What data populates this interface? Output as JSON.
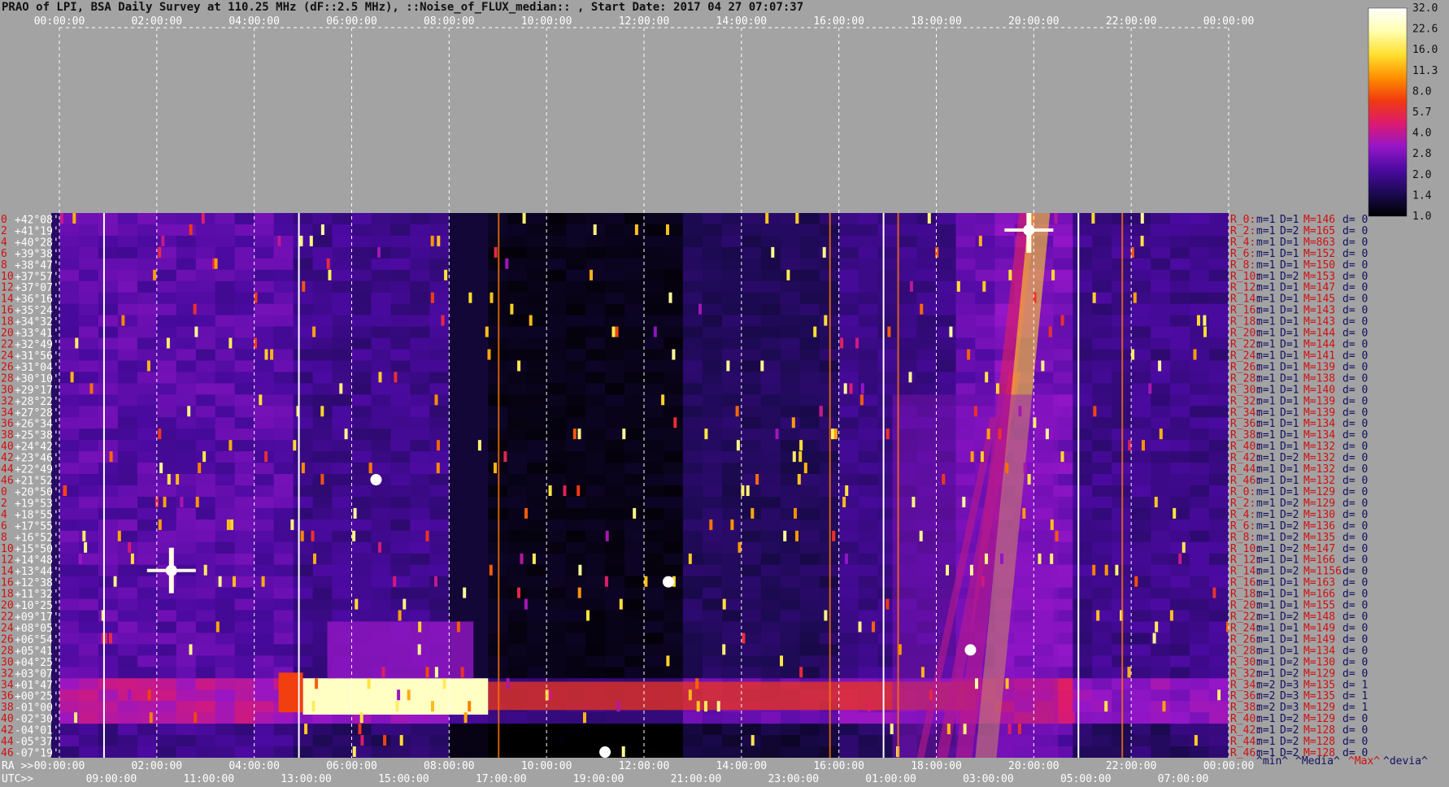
{
  "title": "PRAO of LPI, BSA Daily Survey at 110.25 MHz (dF::2.5 MHz), ::Noise_of_FLUX_median:: , Start Date: 2017 04 27 07:07:37",
  "chart_data": {
    "type": "heatmap",
    "top_axis_labels": [
      "00:00:00",
      "02:00:00",
      "04:00:00",
      "06:00:00",
      "08:00:00",
      "10:00:00",
      "12:00:00",
      "14:00:00",
      "16:00:00",
      "18:00:00",
      "20:00:00",
      "22:00:00",
      "00:00:00"
    ],
    "ra_axis_prefix": "RA >>",
    "ra_axis_labels": [
      "00:00:00",
      "02:00:00",
      "04:00:00",
      "06:00:00",
      "08:00:00",
      "10:00:00",
      "12:00:00",
      "14:00:00",
      "16:00:00",
      "18:00:00",
      "20:00:00",
      "22:00:00",
      "00:00:00"
    ],
    "utc_axis_prefix": "UTC>>",
    "utc_axis_labels": [
      "09:00:00",
      "11:00:00",
      "13:00:00",
      "15:00:00",
      "17:00:00",
      "19:00:00",
      "21:00:00",
      "23:00:00",
      "01:00:00",
      "03:00:00",
      "05:00:00",
      "07:00:00"
    ],
    "declinations": [
      "+42°08'",
      "+41°19'",
      "+40°28'",
      "+39°38'",
      "+38°47'",
      "+37°57'",
      "+37°07'",
      "+36°16'",
      "+35°24'",
      "+34°32'",
      "+33°41'",
      "+32°49'",
      "+31°56'",
      "+31°04'",
      "+30°10'",
      "+29°17'",
      "+28°22'",
      "+27°28'",
      "+26°34'",
      "+25°38'",
      "+24°42'",
      "+23°46'",
      "+22°49'",
      "+21°52'",
      "+20°50'",
      "+19°53'",
      "+18°55'",
      "+17°55'",
      "+16°52'",
      "+15°50'",
      "+14°48'",
      "+13°44'",
      "+12°38'",
      "+11°32'",
      "+10°25'",
      "+09°17'",
      "+08°05'",
      "+06°54'",
      "+05°41'",
      "+04°25'",
      "+03°07'",
      "+01°47'",
      "+00°25'",
      "-01°00'",
      "-02°30'",
      "-04°01'",
      "-05°37'",
      "-07°19'"
    ],
    "row_numbers_left": [
      "0",
      "2",
      "4",
      "6",
      "8",
      "10",
      "12",
      "14",
      "16",
      "18",
      "20",
      "22",
      "24",
      "26",
      "28",
      "30",
      "32",
      "34",
      "36",
      "38",
      "40",
      "42",
      "44",
      "46",
      "0",
      "2",
      "4",
      "6",
      "8",
      "10",
      "12",
      "14",
      "16",
      "18",
      "20",
      "22",
      "24",
      "26",
      "28",
      "30",
      "32",
      "34",
      "36",
      "38",
      "40",
      "42",
      "44",
      "46"
    ],
    "right_stats": [
      {
        "r": "R_0:",
        "m": "m=1",
        "d": "D=1",
        "M": "M=146",
        "dev": "d= 0"
      },
      {
        "r": "R_2:",
        "m": "m=1",
        "d": "D=2",
        "M": "M=165",
        "dev": "d= 0"
      },
      {
        "r": "R_4:",
        "m": "m=1",
        "d": "D=1",
        "M": "M=863",
        "dev": "d= 0"
      },
      {
        "r": "R_6:",
        "m": "m=1",
        "d": "D=1",
        "M": "M=152",
        "dev": "d= 0"
      },
      {
        "r": "R_8:",
        "m": "m=1",
        "d": "D=1",
        "M": "M=150",
        "dev": "d= 0"
      },
      {
        "r": "R_10:",
        "m": "m=1",
        "d": "D=2",
        "M": "M=153",
        "dev": "d= 0"
      },
      {
        "r": "R_12:",
        "m": "m=1",
        "d": "D=1",
        "M": "M=147",
        "dev": "d= 0"
      },
      {
        "r": "R_14:",
        "m": "m=1",
        "d": "D=1",
        "M": "M=145",
        "dev": "d= 0"
      },
      {
        "r": "R_16:",
        "m": "m=1",
        "d": "D=1",
        "M": "M=143",
        "dev": "d= 0"
      },
      {
        "r": "R_18:",
        "m": "m=1",
        "d": "D=1",
        "M": "M=143",
        "dev": "d= 0"
      },
      {
        "r": "R_20:",
        "m": "m=1",
        "d": "D=1",
        "M": "M=144",
        "dev": "d= 0"
      },
      {
        "r": "R_22:",
        "m": "m=1",
        "d": "D=1",
        "M": "M=144",
        "dev": "d= 0"
      },
      {
        "r": "R_24:",
        "m": "m=1",
        "d": "D=1",
        "M": "M=141",
        "dev": "d= 0"
      },
      {
        "r": "R_26:",
        "m": "m=1",
        "d": "D=1",
        "M": "M=139",
        "dev": "d= 0"
      },
      {
        "r": "R_28:",
        "m": "m=1",
        "d": "D=1",
        "M": "M=138",
        "dev": "d= 0"
      },
      {
        "r": "R_30:",
        "m": "m=1",
        "d": "D=1",
        "M": "M=140",
        "dev": "d= 0"
      },
      {
        "r": "R_32:",
        "m": "m=1",
        "d": "D=1",
        "M": "M=139",
        "dev": "d= 0"
      },
      {
        "r": "R_34:",
        "m": "m=1",
        "d": "D=1",
        "M": "M=139",
        "dev": "d= 0"
      },
      {
        "r": "R_36:",
        "m": "m=1",
        "d": "D=1",
        "M": "M=134",
        "dev": "d= 0"
      },
      {
        "r": "R_38:",
        "m": "m=1",
        "d": "D=1",
        "M": "M=134",
        "dev": "d= 0"
      },
      {
        "r": "R_40:",
        "m": "m=1",
        "d": "D=1",
        "M": "M=132",
        "dev": "d= 0"
      },
      {
        "r": "R_42:",
        "m": "m=1",
        "d": "D=2",
        "M": "M=132",
        "dev": "d= 0"
      },
      {
        "r": "R_44:",
        "m": "m=1",
        "d": "D=1",
        "M": "M=132",
        "dev": "d= 0"
      },
      {
        "r": "R_46:",
        "m": "m=1",
        "d": "D=1",
        "M": "M=132",
        "dev": "d= 0"
      },
      {
        "r": "R_0:",
        "m": "m=1",
        "d": "D=1",
        "M": "M=129",
        "dev": "d= 0"
      },
      {
        "r": "R_2:",
        "m": "m=1",
        "d": "D=2",
        "M": "M=129",
        "dev": "d= 0"
      },
      {
        "r": "R_4:",
        "m": "m=1",
        "d": "D=2",
        "M": "M=130",
        "dev": "d= 0"
      },
      {
        "r": "R_6:",
        "m": "m=1",
        "d": "D=2",
        "M": "M=136",
        "dev": "d= 0"
      },
      {
        "r": "R_8:",
        "m": "m=1",
        "d": "D=2",
        "M": "M=135",
        "dev": "d= 0"
      },
      {
        "r": "R_10:",
        "m": "m=1",
        "d": "D=2",
        "M": "M=147",
        "dev": "d= 0"
      },
      {
        "r": "R_12:",
        "m": "m=1",
        "d": "D=1",
        "M": "M=166",
        "dev": "d= 0"
      },
      {
        "r": "R_14:",
        "m": "m=1",
        "d": "D=2",
        "M": "M=1156",
        "dev": "d= 0"
      },
      {
        "r": "R_16:",
        "m": "m=1",
        "d": "D=1",
        "M": "M=163",
        "dev": "d= 0"
      },
      {
        "r": "R_18:",
        "m": "m=1",
        "d": "D=1",
        "M": "M=166",
        "dev": "d= 0"
      },
      {
        "r": "R_20:",
        "m": "m=1",
        "d": "D=1",
        "M": "M=155",
        "dev": "d= 0"
      },
      {
        "r": "R_22:",
        "m": "m=1",
        "d": "D=2",
        "M": "M=148",
        "dev": "d= 0"
      },
      {
        "r": "R_24:",
        "m": "m=1",
        "d": "D=1",
        "M": "M=149",
        "dev": "d= 0"
      },
      {
        "r": "R_26:",
        "m": "m=1",
        "d": "D=1",
        "M": "M=149",
        "dev": "d= 0"
      },
      {
        "r": "R_28:",
        "m": "m=1",
        "d": "D=1",
        "M": "M=134",
        "dev": "d= 0"
      },
      {
        "r": "R_30:",
        "m": "m=1",
        "d": "D=2",
        "M": "M=130",
        "dev": "d= 0"
      },
      {
        "r": "R_32:",
        "m": "m=1",
        "d": "D=2",
        "M": "M=129",
        "dev": "d= 0"
      },
      {
        "r": "R_34:",
        "m": "m=2",
        "d": "D=3",
        "M": "M=135",
        "dev": "d= 1"
      },
      {
        "r": "R_36:",
        "m": "m=2",
        "d": "D=3",
        "M": "M=135",
        "dev": "d= 1"
      },
      {
        "r": "R_38:",
        "m": "m=2",
        "d": "D=3",
        "M": "M=129",
        "dev": "d= 1"
      },
      {
        "r": "R_40:",
        "m": "m=1",
        "d": "D=2",
        "M": "M=129",
        "dev": "d= 0"
      },
      {
        "r": "R_42:",
        "m": "m=1",
        "d": "D=2",
        "M": "M=128",
        "dev": "d= 0"
      },
      {
        "r": "R_44:",
        "m": "m=1",
        "d": "D=2",
        "M": "M=128",
        "dev": "d= 0"
      },
      {
        "r": "R_46:",
        "m": "m=1",
        "d": "D=2",
        "M": "M=128",
        "dev": "d= 0"
      }
    ],
    "stats_legend": [
      "^min^",
      "^Media^",
      "^Max^",
      "^devia^"
    ],
    "colorbar_ticks": [
      "32.0",
      "22.6",
      "16.0",
      "11.3",
      "8.0",
      "5.7",
      "4.0",
      "2.8",
      "2.0",
      "1.4",
      "1.0"
    ],
    "colorbar_range": [
      1.0,
      32.0
    ],
    "colorbar_scale": "log",
    "colormap": [
      "#000000",
      "#1c0a52",
      "#4a0aa0",
      "#9416c8",
      "#dc1a70",
      "#f03a10",
      "#ff9000",
      "#ffe030",
      "#ffffb0",
      "#ffffff"
    ],
    "colors": {
      "stat_label": "#d01010",
      "stat_value": "#101060",
      "dec_label": "#ffffff",
      "row_number": "#d01010",
      "axis_text": "#ffffff",
      "title_text": "#111111",
      "background": "#a3a3a3"
    },
    "bright_sources": [
      {
        "ra_hours": 2.3,
        "dec_row": 31,
        "note": "cross"
      },
      {
        "ra_hours": 19.9,
        "dec_row": 1,
        "note": "cross"
      },
      {
        "ra_hours": 6.5,
        "dec_row": 23,
        "note": "blob"
      },
      {
        "ra_hours": 12.5,
        "dec_row": 32,
        "note": "blob"
      },
      {
        "ra_hours": 11.2,
        "dec_row": 47,
        "note": "blob"
      },
      {
        "ra_hours": 18.7,
        "dec_row": 38,
        "note": "blob"
      }
    ],
    "white_vertical_lines_ra_hours": [
      0.9,
      4.9,
      16.9,
      20.9
    ],
    "red_vertical_lines_ra_hours": [
      9.0,
      15.8,
      17.2,
      21.8
    ]
  }
}
